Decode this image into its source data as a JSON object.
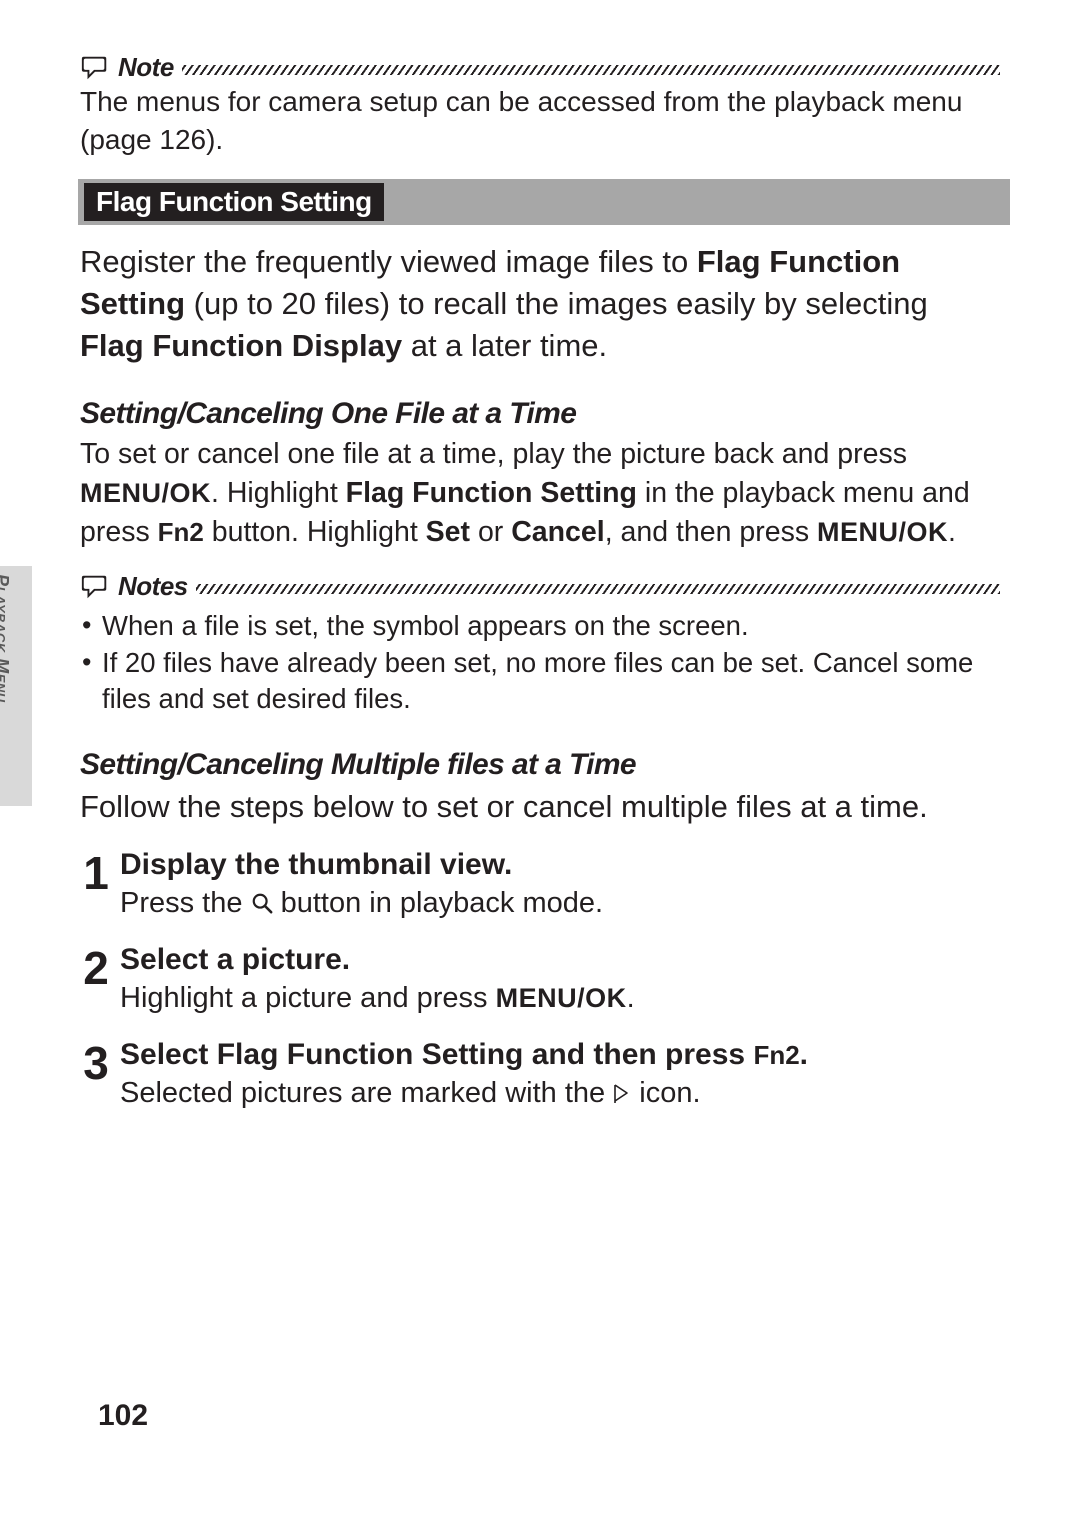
{
  "note1": {
    "label": "Note",
    "body": "The menus for camera setup can be accessed from the playback menu (page 126)."
  },
  "section": {
    "title": "Flag Function Setting"
  },
  "intro": {
    "t1": "Register the frequently viewed image files to ",
    "b1": "Flag Function Setting",
    "t2": " (up to 20 files) to recall the images easily by selecting ",
    "b2": "Flag Function Display",
    "t3": " at a later time."
  },
  "sub1": {
    "heading": "Setting/Canceling One File at a Time",
    "p1a": "To set or cancel one file at a time, play the picture back and press ",
    "menuok": "MENU/OK",
    "p1b": ". Highlight ",
    "b1": "Flag Function Setting",
    "p1c": " in the playback menu and press ",
    "fn2": "Fn2",
    "p1d": " button. Highlight ",
    "b2": "Set",
    "p1e": " or ",
    "b3": "Cancel",
    "p1f": ", and then press ",
    "p1g": "."
  },
  "notes2": {
    "label": "Notes",
    "items": [
      "When a file is set, the symbol appears on the screen.",
      "If 20 files have already been set, no more files can be set. Cancel some files and set desired files."
    ]
  },
  "sub2": {
    "heading": "Setting/Canceling Multiple files at a Time",
    "lead": "Follow the steps below to set or cancel multiple files at a time."
  },
  "steps": [
    {
      "num": "1",
      "title": "Display the thumbnail view.",
      "text_a": "Press the ",
      "text_b": " button in playback mode."
    },
    {
      "num": "2",
      "title": "Select a picture.",
      "text_a": "Highlight a picture and press ",
      "menuok": "MENU/OK",
      "text_b": "."
    },
    {
      "num": "3",
      "title_a": "Select ",
      "title_b": "Flag Function Setting",
      "title_c": " and then press ",
      "title_fn2": "Fn2",
      "title_d": ".",
      "text_a": "Selected pictures are marked with the ",
      "text_b": " icon."
    }
  ],
  "side": {
    "label": "Playback Menu"
  },
  "page": {
    "num": "102"
  }
}
